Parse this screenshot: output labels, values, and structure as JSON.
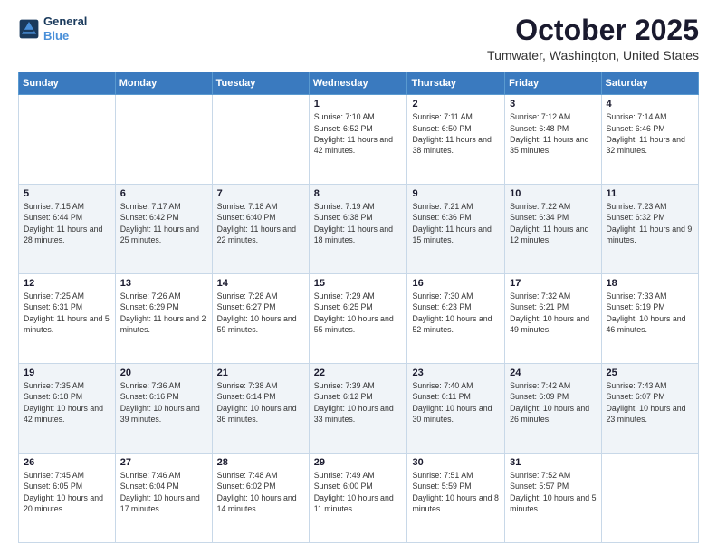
{
  "header": {
    "logo_line1": "General",
    "logo_line2": "Blue",
    "title": "October 2025",
    "subtitle": "Tumwater, Washington, United States"
  },
  "calendar": {
    "weekdays": [
      "Sunday",
      "Monday",
      "Tuesday",
      "Wednesday",
      "Thursday",
      "Friday",
      "Saturday"
    ],
    "rows": [
      [
        {
          "day": "",
          "info": ""
        },
        {
          "day": "",
          "info": ""
        },
        {
          "day": "",
          "info": ""
        },
        {
          "day": "1",
          "info": "Sunrise: 7:10 AM\nSunset: 6:52 PM\nDaylight: 11 hours\nand 42 minutes."
        },
        {
          "day": "2",
          "info": "Sunrise: 7:11 AM\nSunset: 6:50 PM\nDaylight: 11 hours\nand 38 minutes."
        },
        {
          "day": "3",
          "info": "Sunrise: 7:12 AM\nSunset: 6:48 PM\nDaylight: 11 hours\nand 35 minutes."
        },
        {
          "day": "4",
          "info": "Sunrise: 7:14 AM\nSunset: 6:46 PM\nDaylight: 11 hours\nand 32 minutes."
        }
      ],
      [
        {
          "day": "5",
          "info": "Sunrise: 7:15 AM\nSunset: 6:44 PM\nDaylight: 11 hours\nand 28 minutes."
        },
        {
          "day": "6",
          "info": "Sunrise: 7:17 AM\nSunset: 6:42 PM\nDaylight: 11 hours\nand 25 minutes."
        },
        {
          "day": "7",
          "info": "Sunrise: 7:18 AM\nSunset: 6:40 PM\nDaylight: 11 hours\nand 22 minutes."
        },
        {
          "day": "8",
          "info": "Sunrise: 7:19 AM\nSunset: 6:38 PM\nDaylight: 11 hours\nand 18 minutes."
        },
        {
          "day": "9",
          "info": "Sunrise: 7:21 AM\nSunset: 6:36 PM\nDaylight: 11 hours\nand 15 minutes."
        },
        {
          "day": "10",
          "info": "Sunrise: 7:22 AM\nSunset: 6:34 PM\nDaylight: 11 hours\nand 12 minutes."
        },
        {
          "day": "11",
          "info": "Sunrise: 7:23 AM\nSunset: 6:32 PM\nDaylight: 11 hours\nand 9 minutes."
        }
      ],
      [
        {
          "day": "12",
          "info": "Sunrise: 7:25 AM\nSunset: 6:31 PM\nDaylight: 11 hours\nand 5 minutes."
        },
        {
          "day": "13",
          "info": "Sunrise: 7:26 AM\nSunset: 6:29 PM\nDaylight: 11 hours\nand 2 minutes."
        },
        {
          "day": "14",
          "info": "Sunrise: 7:28 AM\nSunset: 6:27 PM\nDaylight: 10 hours\nand 59 minutes."
        },
        {
          "day": "15",
          "info": "Sunrise: 7:29 AM\nSunset: 6:25 PM\nDaylight: 10 hours\nand 55 minutes."
        },
        {
          "day": "16",
          "info": "Sunrise: 7:30 AM\nSunset: 6:23 PM\nDaylight: 10 hours\nand 52 minutes."
        },
        {
          "day": "17",
          "info": "Sunrise: 7:32 AM\nSunset: 6:21 PM\nDaylight: 10 hours\nand 49 minutes."
        },
        {
          "day": "18",
          "info": "Sunrise: 7:33 AM\nSunset: 6:19 PM\nDaylight: 10 hours\nand 46 minutes."
        }
      ],
      [
        {
          "day": "19",
          "info": "Sunrise: 7:35 AM\nSunset: 6:18 PM\nDaylight: 10 hours\nand 42 minutes."
        },
        {
          "day": "20",
          "info": "Sunrise: 7:36 AM\nSunset: 6:16 PM\nDaylight: 10 hours\nand 39 minutes."
        },
        {
          "day": "21",
          "info": "Sunrise: 7:38 AM\nSunset: 6:14 PM\nDaylight: 10 hours\nand 36 minutes."
        },
        {
          "day": "22",
          "info": "Sunrise: 7:39 AM\nSunset: 6:12 PM\nDaylight: 10 hours\nand 33 minutes."
        },
        {
          "day": "23",
          "info": "Sunrise: 7:40 AM\nSunset: 6:11 PM\nDaylight: 10 hours\nand 30 minutes."
        },
        {
          "day": "24",
          "info": "Sunrise: 7:42 AM\nSunset: 6:09 PM\nDaylight: 10 hours\nand 26 minutes."
        },
        {
          "day": "25",
          "info": "Sunrise: 7:43 AM\nSunset: 6:07 PM\nDaylight: 10 hours\nand 23 minutes."
        }
      ],
      [
        {
          "day": "26",
          "info": "Sunrise: 7:45 AM\nSunset: 6:05 PM\nDaylight: 10 hours\nand 20 minutes."
        },
        {
          "day": "27",
          "info": "Sunrise: 7:46 AM\nSunset: 6:04 PM\nDaylight: 10 hours\nand 17 minutes."
        },
        {
          "day": "28",
          "info": "Sunrise: 7:48 AM\nSunset: 6:02 PM\nDaylight: 10 hours\nand 14 minutes."
        },
        {
          "day": "29",
          "info": "Sunrise: 7:49 AM\nSunset: 6:00 PM\nDaylight: 10 hours\nand 11 minutes."
        },
        {
          "day": "30",
          "info": "Sunrise: 7:51 AM\nSunset: 5:59 PM\nDaylight: 10 hours\nand 8 minutes."
        },
        {
          "day": "31",
          "info": "Sunrise: 7:52 AM\nSunset: 5:57 PM\nDaylight: 10 hours\nand 5 minutes."
        },
        {
          "day": "",
          "info": ""
        }
      ]
    ]
  }
}
